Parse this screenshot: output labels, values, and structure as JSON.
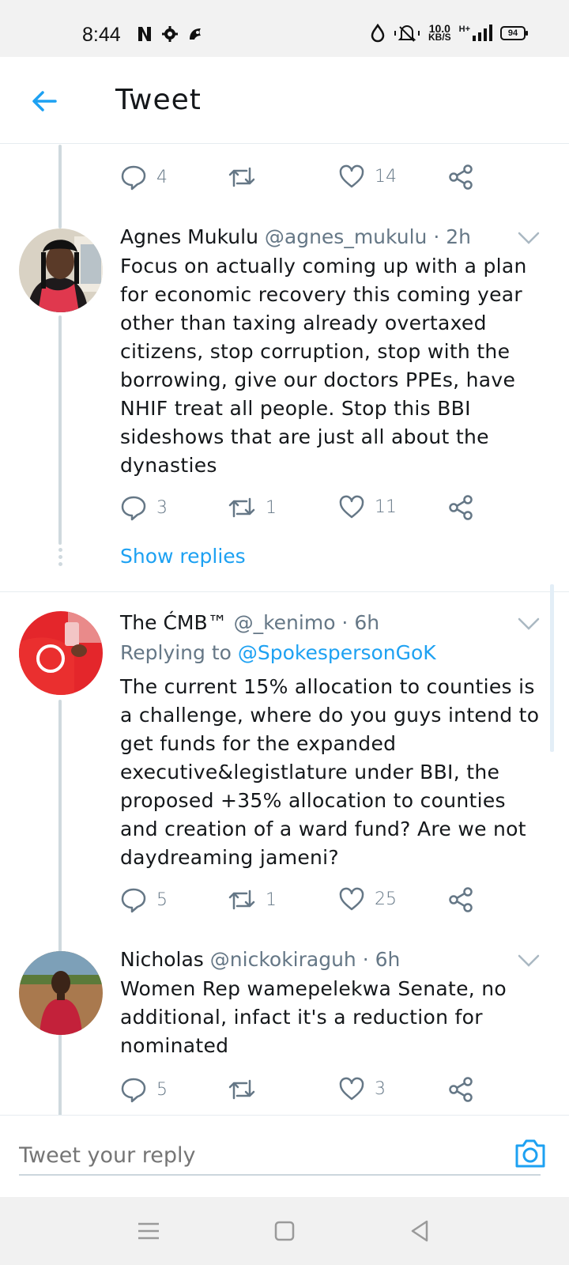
{
  "status_bar": {
    "time": "8:44",
    "speed_value": "10.0",
    "speed_unit": "KB/S",
    "network": "H+",
    "battery": "94"
  },
  "header": {
    "title": "Tweet"
  },
  "top_actions": {
    "replies": "4",
    "retweets": "",
    "likes": "14"
  },
  "tweets": [
    {
      "name": "Agnes Mukulu",
      "handle": "@agnes_mukulu · 2h",
      "text": "Focus on actually coming up with a plan for economic recovery this coming year other than taxing already overtaxed citizens, stop corruption, stop with the borrowing, give our doctors PPEs, have NHIF treat all people. Stop this BBI sideshows that are just all about the dynasties",
      "replies": "3",
      "retweets": "1",
      "likes": "11",
      "show_replies": "Show replies"
    },
    {
      "name": "The ĆMB™",
      "handle": "@_kenimo · 6h",
      "replying_prefix": "Replying to ",
      "replying_to": "@SpokespersonGoK",
      "text": "The current 15% allocation to counties is a challenge, where do you guys intend to get funds for the expanded executive&legistlature under BBI, the proposed +35% allocation to counties and creation of a ward fund? Are we not daydreaming jameni?",
      "replies": "5",
      "retweets": "1",
      "likes": "25"
    },
    {
      "name": "Nicholas",
      "handle": "@nickokiraguh · 6h",
      "text": "Women Rep wamepelekwa Senate, no additional, infact it's a reduction for nominated",
      "replies": "5",
      "retweets": "",
      "likes": "3"
    }
  ],
  "reply_bar": {
    "placeholder": "Tweet your reply"
  },
  "colors": {
    "accent": "#1da1f2",
    "muted": "#657786",
    "text": "#14171a",
    "thread_line": "#cfd9de"
  }
}
